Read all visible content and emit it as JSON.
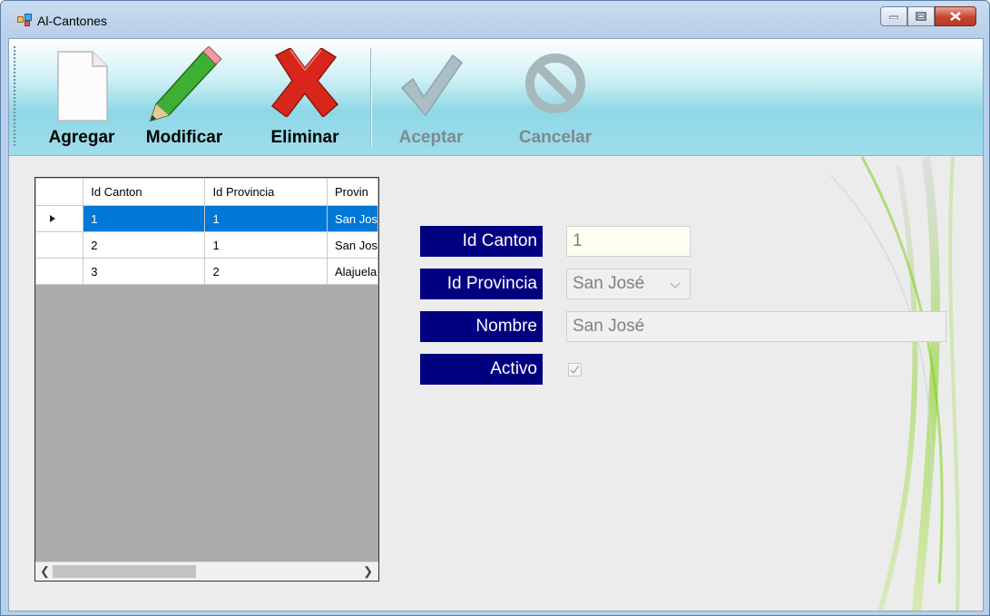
{
  "window": {
    "title": "Al-Cantones"
  },
  "toolbar": {
    "buttons": [
      {
        "label": "Agregar",
        "icon": "new-document-icon",
        "enabled": true
      },
      {
        "label": "Modificar",
        "icon": "pencil-icon",
        "enabled": true
      },
      {
        "label": "Eliminar",
        "icon": "red-x-icon",
        "enabled": true
      },
      {
        "label": "Aceptar",
        "icon": "checkmark-icon",
        "enabled": false
      },
      {
        "label": "Cancelar",
        "icon": "prohibited-icon",
        "enabled": false
      }
    ]
  },
  "grid": {
    "columns": [
      "Id Canton",
      "Id Provincia",
      "Provin"
    ],
    "rows": [
      {
        "id_canton": "1",
        "id_provincia": "1",
        "provincia": "San Jos",
        "selected": true
      },
      {
        "id_canton": "2",
        "id_provincia": "1",
        "provincia": "San Jos",
        "selected": false
      },
      {
        "id_canton": "3",
        "id_provincia": "2",
        "provincia": "Alajuela",
        "selected": false
      }
    ]
  },
  "form": {
    "id_canton_label": "Id Canton",
    "id_canton_value": "1",
    "id_provincia_label": "Id Provincia",
    "id_provincia_value": "San José",
    "nombre_label": "Nombre",
    "nombre_value": "San José",
    "activo_label": "Activo",
    "activo_checked": true
  },
  "colors": {
    "label_bg": "#000080",
    "selection": "#0078d7",
    "toolbar_gradient": "#8fd8e6",
    "accent_green": "#7cd11c"
  }
}
